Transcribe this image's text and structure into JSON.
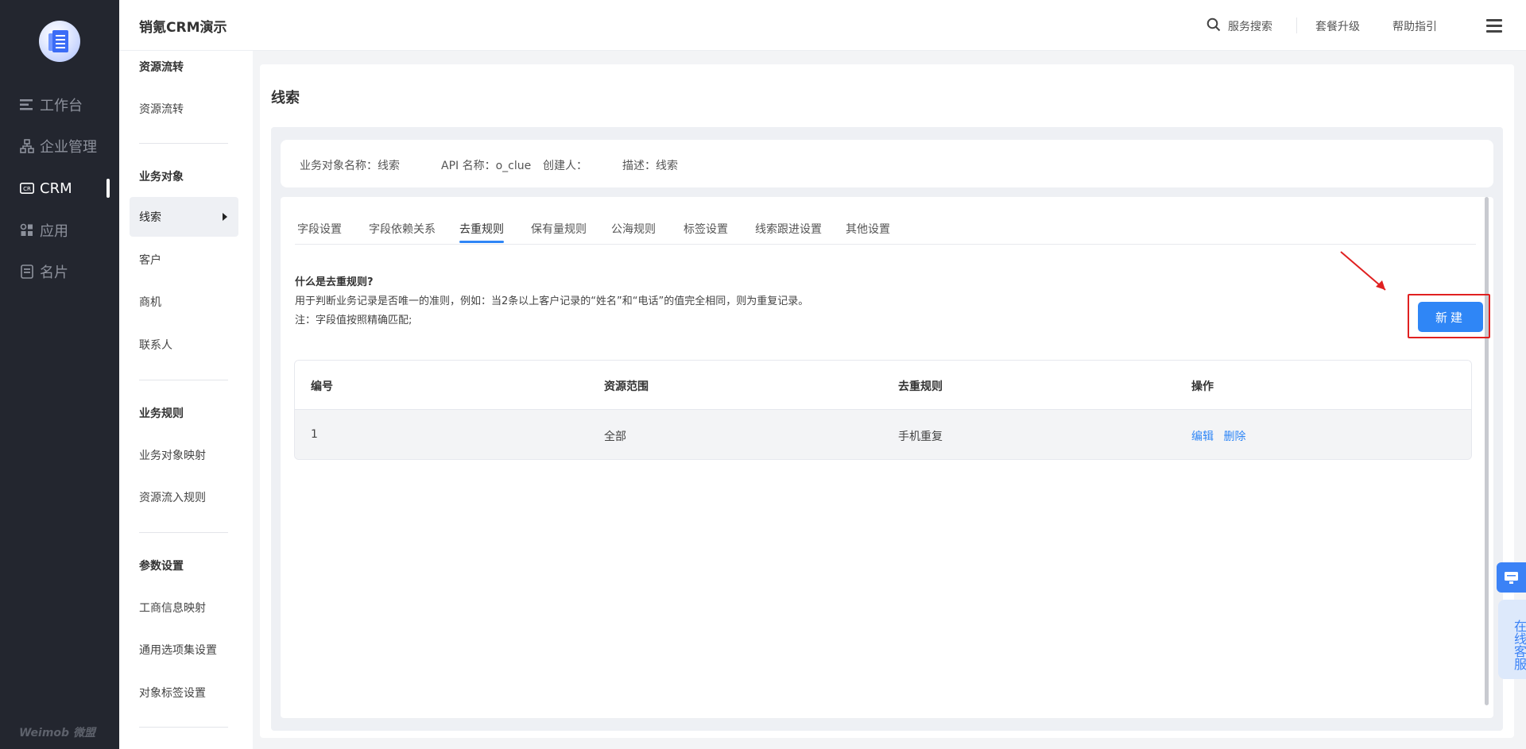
{
  "app": {
    "title": "销氪CRM演示"
  },
  "leftnav": {
    "items": [
      {
        "label": "工作台",
        "icon": "list-icon"
      },
      {
        "label": "企业管理",
        "icon": "org-icon"
      },
      {
        "label": "CRM",
        "icon": "crm-icon",
        "active": true
      },
      {
        "label": "应用",
        "icon": "apps-icon"
      },
      {
        "label": "名片",
        "icon": "card-icon"
      }
    ],
    "brand": "Weimob 微盟"
  },
  "header": {
    "search_label": "服务搜索",
    "upgrade_label": "套餐升级",
    "help_label": "帮助指引"
  },
  "subside": {
    "groups": [
      {
        "title": "资源流转",
        "items": [
          "资源流转"
        ]
      },
      {
        "title": "业务对象",
        "items": [
          "线索",
          "客户",
          "商机",
          "联系人"
        ]
      },
      {
        "title": "业务规则",
        "items": [
          "业务对象映射",
          "资源流入规则"
        ]
      },
      {
        "title": "参数设置",
        "items": [
          "工商信息映射",
          "通用选项集设置",
          "对象标签设置"
        ]
      }
    ],
    "active_item": "线索"
  },
  "page": {
    "title": "线索",
    "info": {
      "name": "业务对象名称：线索",
      "api": "API 名称：o_clue",
      "creator": "创建人：",
      "desc": "描述：线索"
    },
    "tabs": [
      "字段设置",
      "字段依赖关系",
      "去重规则",
      "保有量规则",
      "公海规则",
      "标签设置",
      "线索跟进设置",
      "其他设置"
    ],
    "active_tab": "去重规则",
    "explain": {
      "question": "什么是去重规则?",
      "line1": "用于判断业务记录是否唯一的准则，例如：当2条以上客户记录的“姓名”和“电话”的值完全相同，则为重复记录。",
      "line2": "注：字段值按照精确匹配;"
    },
    "new_button": "新建",
    "table": {
      "headers": [
        "编号",
        "资源范围",
        "去重规则",
        "操作"
      ],
      "rows": [
        {
          "id": "1",
          "scope": "全部",
          "rule": "手机重复",
          "edit": "编辑",
          "delete": "删除"
        }
      ]
    }
  },
  "float_widget": {
    "label": "在线客服"
  },
  "colors": {
    "accent": "#2f86f6",
    "annotation": "#e02020",
    "nav_bg": "#23262f"
  }
}
